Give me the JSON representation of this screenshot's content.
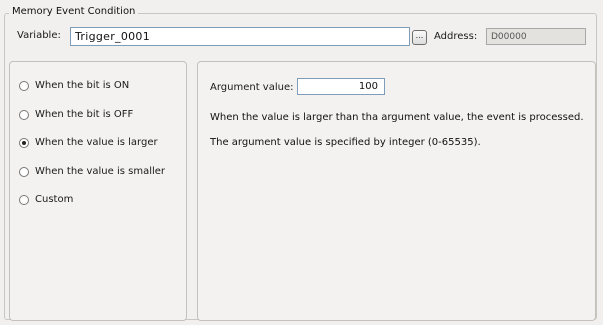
{
  "group": {
    "title": "Memory Event Condition"
  },
  "variable": {
    "label": "Variable:",
    "value": "Trigger_0001",
    "browse_label": "..."
  },
  "address": {
    "label": "Address:",
    "value": "D00000"
  },
  "condition_options": [
    {
      "label": "When the bit is ON",
      "checked": false
    },
    {
      "label": "When the bit is OFF",
      "checked": false
    },
    {
      "label": "When the value is larger",
      "checked": true
    },
    {
      "label": "When the value is smaller",
      "checked": false
    },
    {
      "label": "Custom",
      "checked": false
    }
  ],
  "argument": {
    "label": "Argument value:",
    "value": "100",
    "description_1": "When the value is larger than tha argument value, the event is processed.",
    "description_2": "The argument value is specified by integer (0-65535)."
  }
}
